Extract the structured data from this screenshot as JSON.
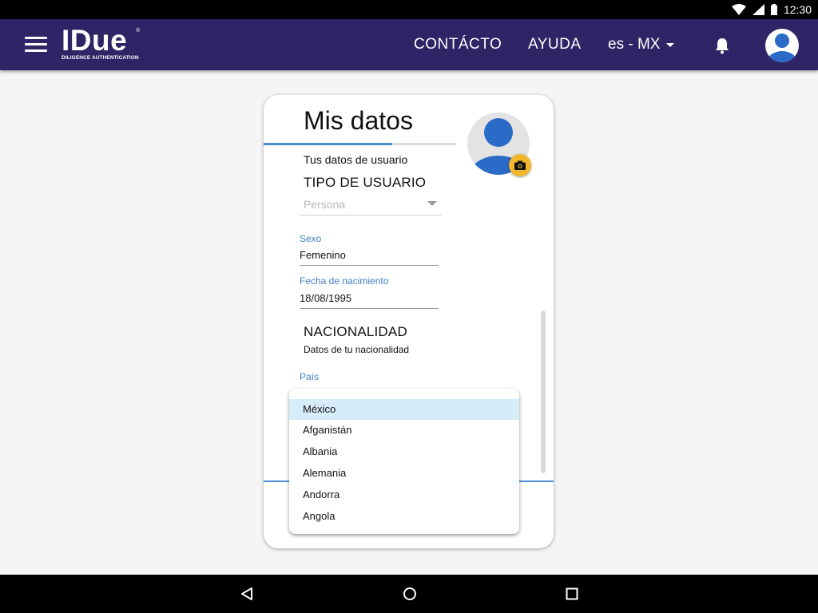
{
  "status_bar": {
    "time": "12:30",
    "icons": [
      "wifi-icon",
      "signal-icon",
      "battery-icon"
    ]
  },
  "app_bar": {
    "logo": {
      "name": "IDue",
      "registered": "®",
      "tagline": "DILIGENCE AUTHENTICATION"
    },
    "nav": {
      "contact": "CONTÁCTO",
      "help": "AYUDA"
    },
    "language": "es - MX",
    "icons": [
      "menu-icon",
      "bell-icon",
      "user-avatar-icon"
    ],
    "color": "#2e2466"
  },
  "card": {
    "title": "Mis datos",
    "progress": 0.67,
    "subtitle": "Tus datos de usuario",
    "user_type": {
      "section_title": "TIPO DE USUARIO",
      "placeholder": "Persona"
    },
    "sex": {
      "label": "Sexo",
      "value": "Femenino"
    },
    "birthdate": {
      "label": "Fecha de nacimiento",
      "value": "18/08/1995"
    },
    "nationality": {
      "section_title": "NACIONALIDAD",
      "subtitle": "Datos de tu nacionalidad"
    },
    "country": {
      "label": "País",
      "selected": "México",
      "options": [
        "México",
        "Afganistán",
        "Albania",
        "Alemania",
        "Andorra",
        "Angola"
      ]
    }
  },
  "colors": {
    "accent_blue": "#3f7ec9",
    "camera_button": "#f2b72c",
    "selected_row": "#d6ecf8"
  }
}
